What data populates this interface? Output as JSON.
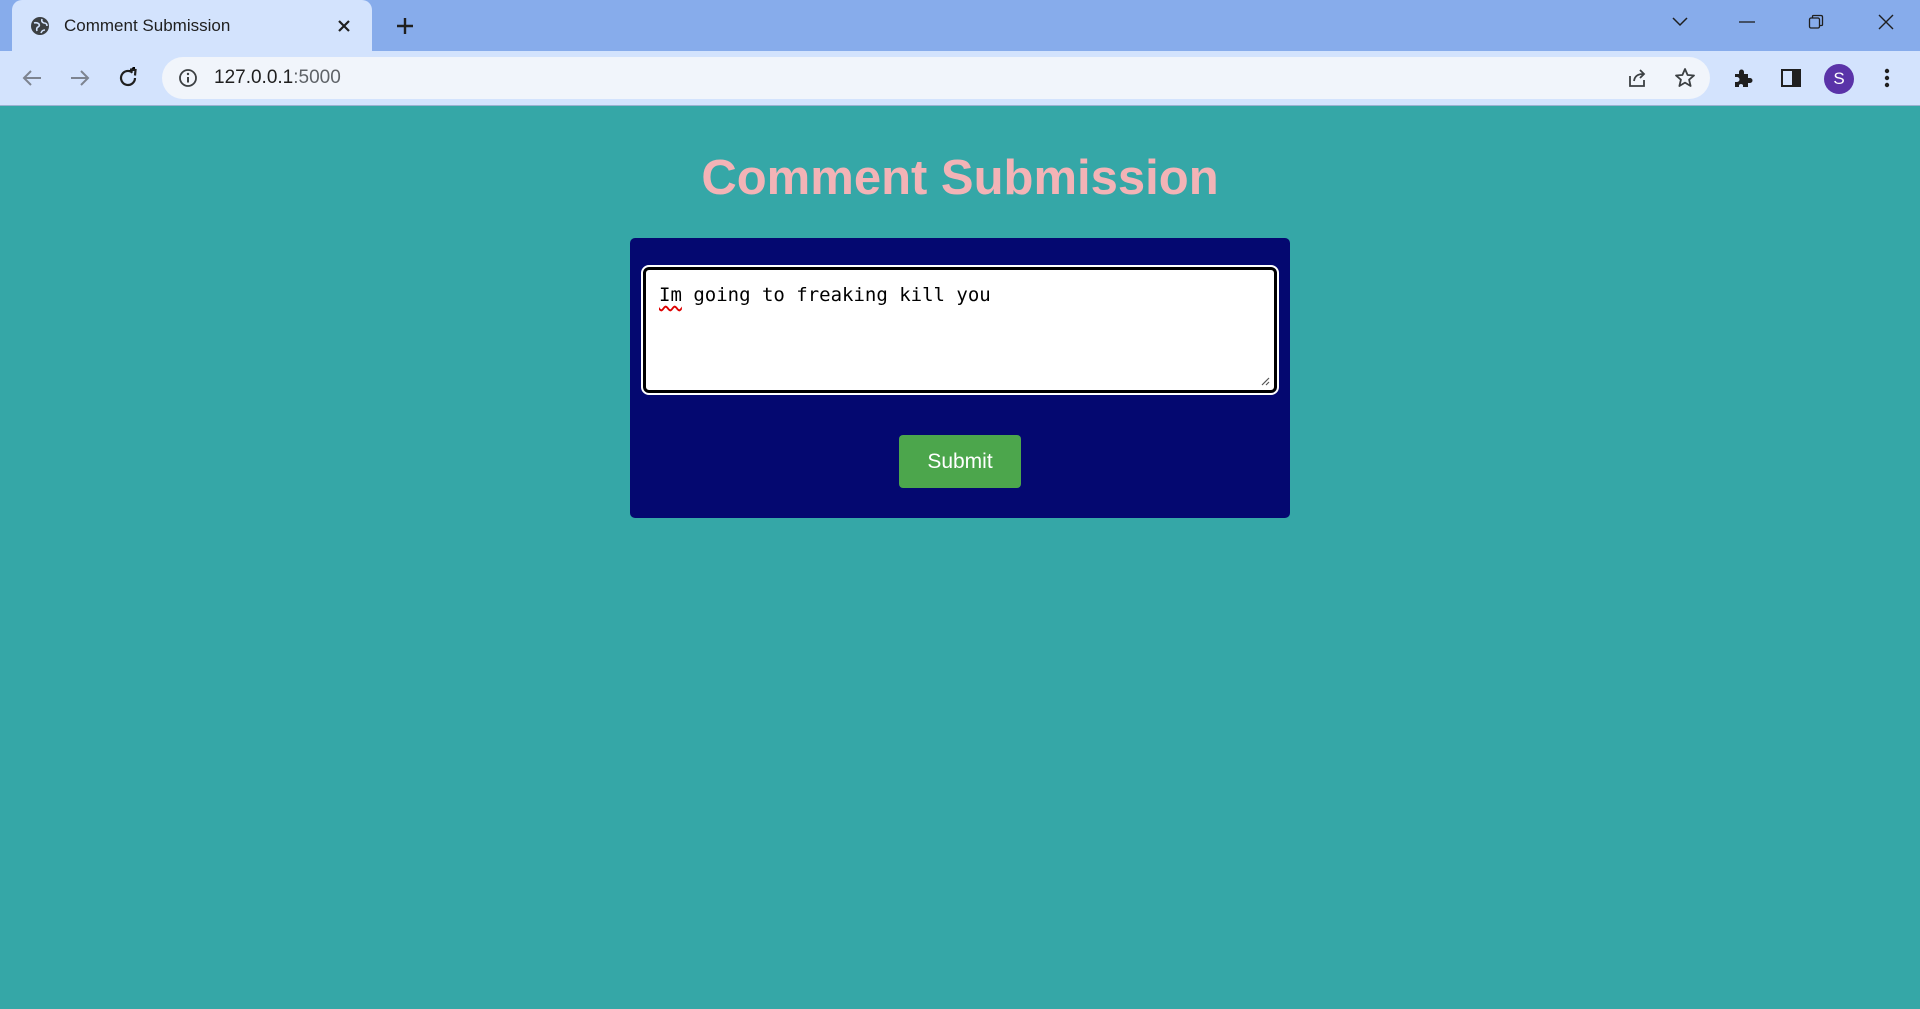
{
  "browser": {
    "tab": {
      "title": "Comment Submission"
    },
    "address_bar": {
      "host": "127.0.0.1",
      "port": ":5000"
    },
    "profile_initial": "S"
  },
  "page": {
    "heading": "Comment Submission",
    "comment_field": {
      "first_word": "Im",
      "rest": " going to freaking kill you"
    },
    "submit_label": "Submit"
  },
  "colors": {
    "page_background": "#35a7a7",
    "card_background": "#040870",
    "heading_color": "#f3b3b6",
    "submit_background": "#4ca64c"
  }
}
